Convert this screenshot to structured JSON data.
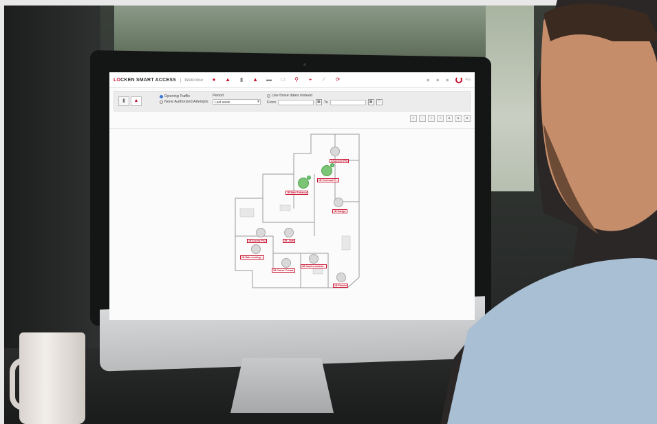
{
  "app": {
    "brand_prefix": "LO",
    "brand_rest": "CKEN SMART ACCESS",
    "welcome": "Welcome",
    "lang": "Fra"
  },
  "filters": {
    "radio_opening": "Opening Traffic",
    "radio_none": "None Authorized Attempts",
    "period_label": "Period",
    "period_value": "Last week",
    "use_dates_label": "Use those dates instead",
    "from_label": "From",
    "to_label": "To"
  },
  "map_tags": [
    "24 Access P26",
    "1B Technical R...",
    "1B Main Entrance",
    "1B Garage",
    "1B Access P02",
    "1B_Jean",
    "1B Main meeting...",
    "1B Carlos' Private",
    "1B Carol's workstt...",
    "1B Pannier"
  ],
  "colors": {
    "accent": "#c8102e",
    "active_lock": "#7cc576"
  },
  "icons": [
    "user-icon",
    "user-add-icon",
    "badge-icon",
    "users-icon",
    "card-icon",
    "calendar-icon",
    "location-icon",
    "plus-icon",
    "tools-icon",
    "refresh-icon",
    "power-icon"
  ]
}
